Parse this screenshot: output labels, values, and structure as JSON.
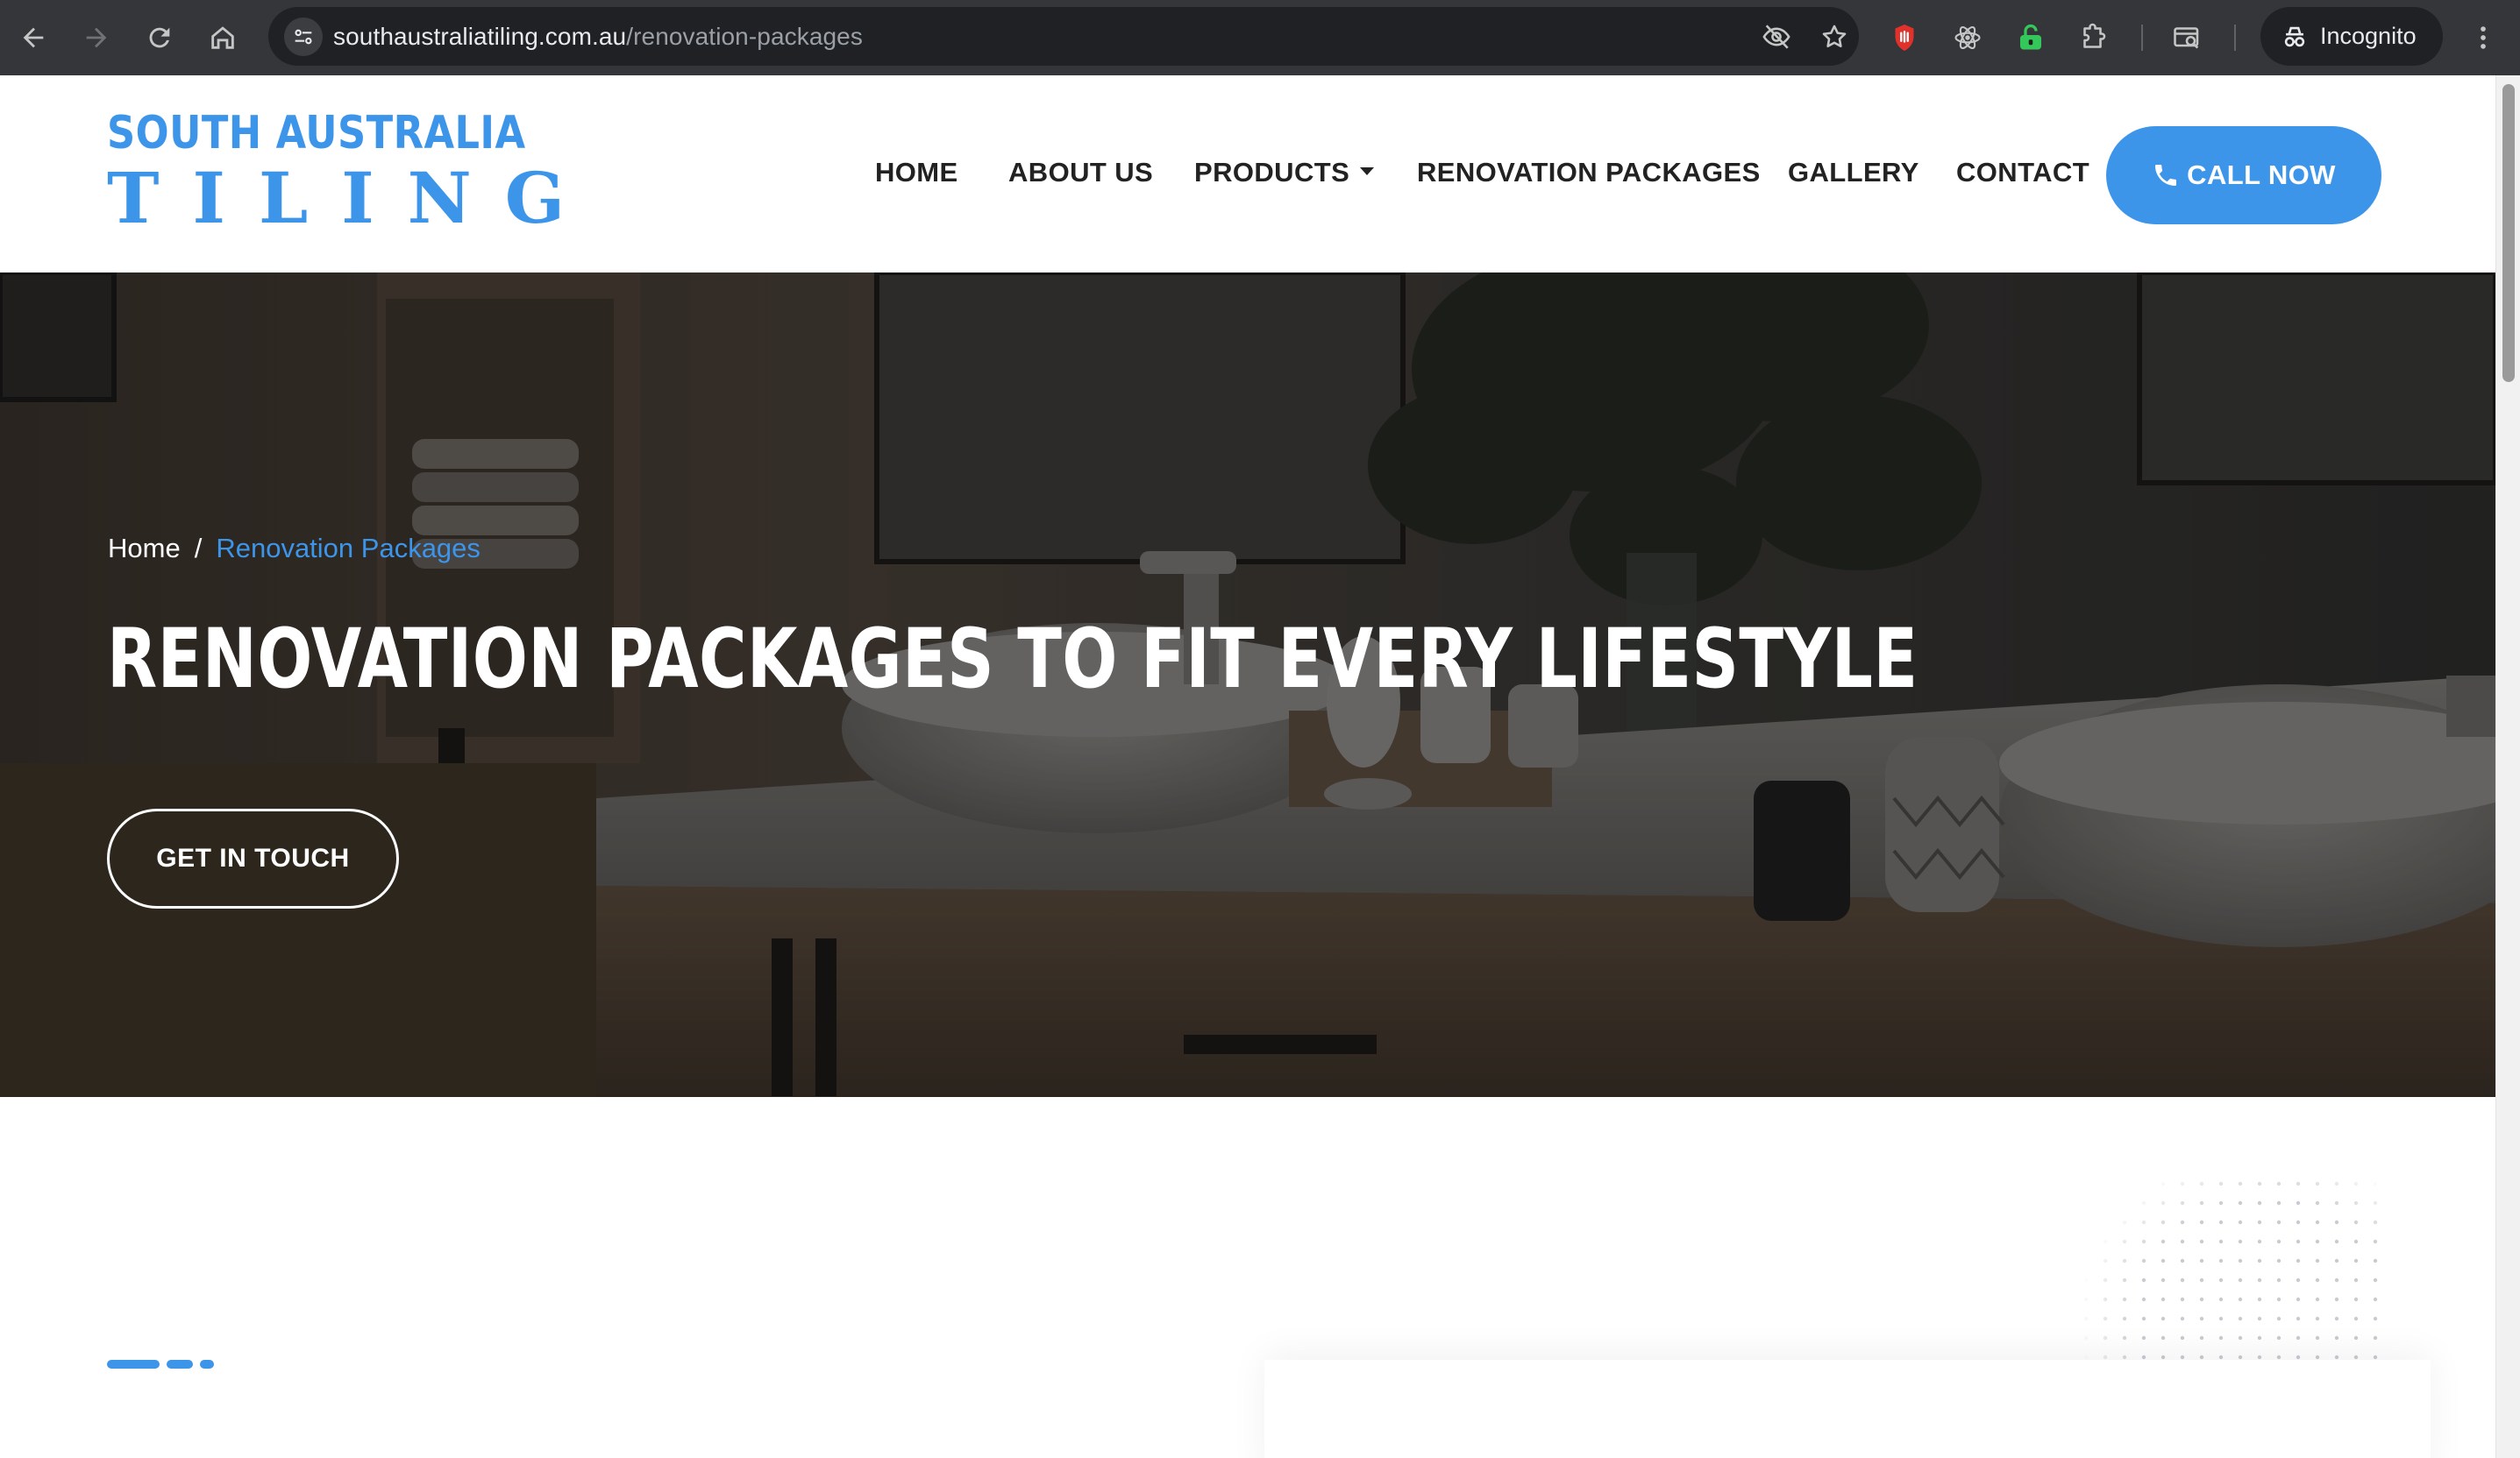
{
  "browser": {
    "url_host": "southaustraliatiling.com.au",
    "url_path": "/renovation-packages",
    "incognito_label": "Incognito",
    "icons": [
      "back-icon",
      "forward-icon",
      "reload-icon",
      "home-icon",
      "tune-icon",
      "eye-off-icon",
      "star-icon",
      "shield-extension-icon",
      "react-extension-icon",
      "lock-extension-icon",
      "puzzle-extension-icon",
      "tab-search-icon",
      "incognito-icon",
      "more-vert-icon"
    ]
  },
  "site": {
    "logo_top": "SOUTH AUSTRALIA",
    "logo_bottom": "TILING",
    "brand_color": "#3d95ea",
    "nav": {
      "home": "HOME",
      "about": "ABOUT US",
      "products": "PRODUCTS",
      "renovation": "RENOVATION PACKAGES",
      "gallery": "GALLERY",
      "contact": "CONTACT"
    },
    "call_button": "CALL NOW"
  },
  "hero": {
    "breadcrumb_home": "Home",
    "breadcrumb_separator": "/",
    "breadcrumb_current": "Renovation Packages",
    "title": "RENOVATION PACKAGES TO FIT EVERY LIFESTYLE",
    "cta": "GET IN TOUCH"
  }
}
